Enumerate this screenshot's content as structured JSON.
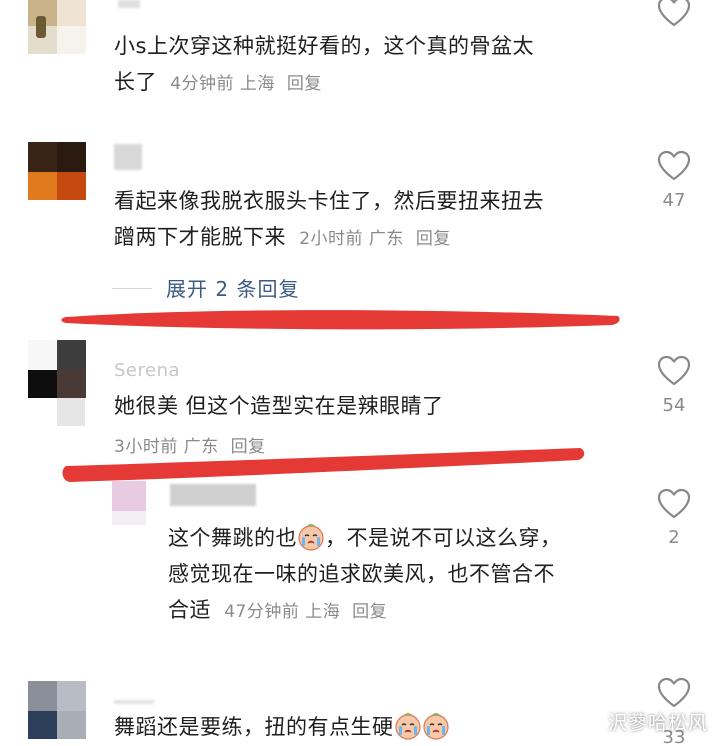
{
  "comments": [
    {
      "text": "小s上次穿这种就挺好看的，这个真的骨盆太长了",
      "line1": "小s上次穿这种就挺好看的，这个真的骨盆太",
      "line2": "长了",
      "time": "4分钟前",
      "location": "上海",
      "reply": "回复",
      "likes": ""
    },
    {
      "line1": "看起来像我脱衣服头卡住了，然后要扭来扭去",
      "line2": "蹭两下才能脱下来",
      "time": "2小时前",
      "location": "广东",
      "reply": "回复",
      "likes": "47",
      "expand": "展开 2 条回复"
    },
    {
      "username": "Serena",
      "line1": "她很美 但这个造型实在是辣眼睛了",
      "time": "3小时前",
      "location": "广东",
      "reply": "回复",
      "likes": "54"
    },
    {
      "line1a": "这个舞跳的也",
      "line1b": "，不是说不可以这么穿，",
      "line2": "感觉现在一味的追求欧美风，也不管合不",
      "line3": "合适",
      "time": "47分钟前",
      "location": "上海",
      "reply": "回复",
      "likes": "2"
    },
    {
      "line1": "舞蹈还是要练，扭的有点生硬",
      "likes": "33"
    }
  ],
  "watermark": "沢蓼哈松风",
  "colors": {
    "annotation_red": "#e53935",
    "link_blue": "#3b5a84",
    "meta_gray": "#8a8a8a"
  },
  "icons": {
    "like": "heart-outline-icon",
    "emoji": "crying-face-emoji"
  }
}
